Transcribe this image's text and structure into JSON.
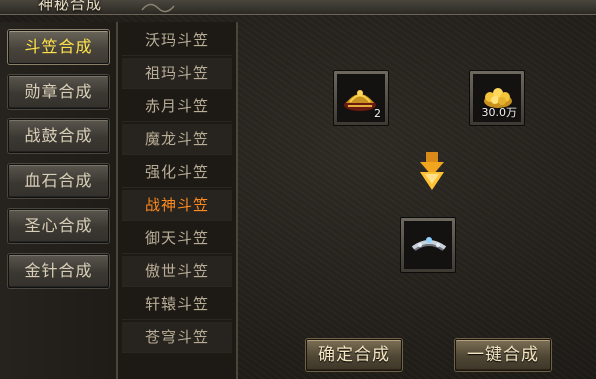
{
  "window": {
    "title": "神秘合成"
  },
  "categories": [
    {
      "label": "斗笠合成",
      "active": true
    },
    {
      "label": "勋章合成",
      "active": false
    },
    {
      "label": "战鼓合成",
      "active": false
    },
    {
      "label": "血石合成",
      "active": false
    },
    {
      "label": "圣心合成",
      "active": false
    },
    {
      "label": "金针合成",
      "active": false
    }
  ],
  "items": [
    {
      "label": "沃玛斗笠"
    },
    {
      "label": "祖玛斗笠"
    },
    {
      "label": "赤月斗笠"
    },
    {
      "label": "魔龙斗笠"
    },
    {
      "label": "强化斗笠"
    },
    {
      "label": "战神斗笠",
      "active": true
    },
    {
      "label": "御天斗笠"
    },
    {
      "label": "傲世斗笠"
    },
    {
      "label": "轩辕斗笠"
    },
    {
      "label": "苍穹斗笠"
    }
  ],
  "materials": {
    "item_slot": {
      "icon": "helmet-icon",
      "count": "2"
    },
    "gold_slot": {
      "icon": "gold-coins-icon",
      "count": "30.0万"
    }
  },
  "result": {
    "icon": "circlet-icon"
  },
  "buttons": {
    "confirm": "确定合成",
    "one_click": "一键合成"
  },
  "colors": {
    "active_category": "#ffe34a",
    "active_item": "#ff8a1f"
  }
}
